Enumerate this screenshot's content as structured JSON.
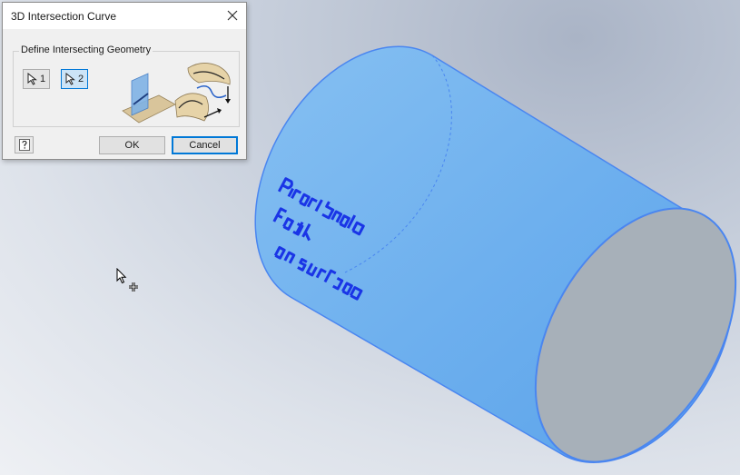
{
  "dialog": {
    "title": "3D Intersection Curve",
    "group_label": "Define Intersecting Geometry",
    "select1_label": "1",
    "select2_label": "2",
    "ok_label": "OK",
    "cancel_label": "Cancel"
  },
  "icons": {
    "close": "close-icon",
    "select1": "select-cursor-icon",
    "select2": "select-cursor-icon",
    "help": "help-icon",
    "illustration": "intersection-illustration-icon",
    "mouse": "mouse-cursor-move-icon"
  },
  "colors": {
    "selected_button": "#cce4f7",
    "accent": "#0078d7",
    "cylinder_fill": "#6fb0ee",
    "cylinder_edge": "#3d7cf0",
    "end_face": "#a6afb8",
    "embossed_text": "#1a35e6"
  }
}
